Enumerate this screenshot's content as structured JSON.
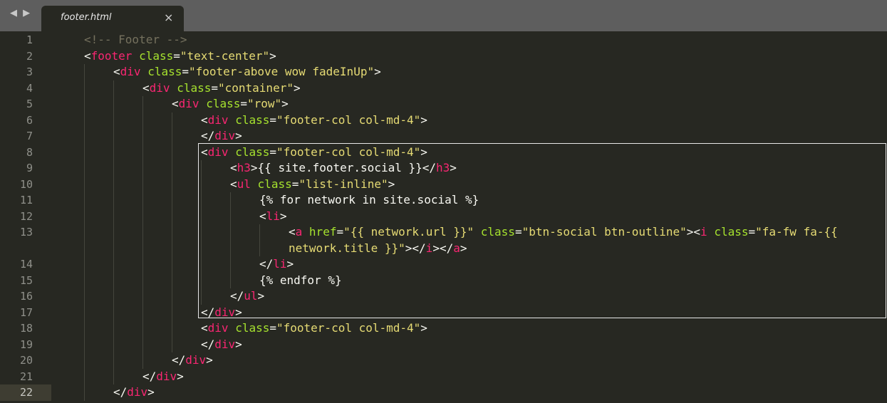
{
  "window": {
    "nav_arrows": "◀ ▶",
    "tab": {
      "title": "footer.html",
      "close": "×"
    }
  },
  "editor": {
    "current_line": 22,
    "theme": {
      "background": "#272822",
      "tag": "#f92672",
      "attribute": "#a6e22e",
      "string": "#e6db74",
      "comment": "#75715e",
      "text": "#f8f8f2"
    },
    "gutter": [
      "1",
      "2",
      "3",
      "4",
      "5",
      "6",
      "7",
      "8",
      "9",
      "10",
      "11",
      "12",
      "13",
      "",
      "14",
      "15",
      "16",
      "17",
      "18",
      "19",
      "20",
      "21",
      "22"
    ],
    "lines": [
      {
        "indent": 1,
        "tokens": [
          {
            "t": "comment",
            "v": "<!-- Footer -->"
          }
        ]
      },
      {
        "indent": 1,
        "tokens": [
          {
            "t": "punc",
            "v": "<"
          },
          {
            "t": "tag",
            "v": "footer"
          },
          {
            "t": "text",
            "v": " "
          },
          {
            "t": "attr",
            "v": "class"
          },
          {
            "t": "punc",
            "v": "="
          },
          {
            "t": "str",
            "v": "\"text-center\""
          },
          {
            "t": "punc",
            "v": ">"
          }
        ]
      },
      {
        "indent": 2,
        "tokens": [
          {
            "t": "punc",
            "v": "<"
          },
          {
            "t": "tag",
            "v": "div"
          },
          {
            "t": "text",
            "v": " "
          },
          {
            "t": "attr",
            "v": "class"
          },
          {
            "t": "punc",
            "v": "="
          },
          {
            "t": "str",
            "v": "\"footer-above wow fadeInUp\""
          },
          {
            "t": "punc",
            "v": ">"
          }
        ]
      },
      {
        "indent": 3,
        "tokens": [
          {
            "t": "punc",
            "v": "<"
          },
          {
            "t": "tag",
            "v": "div"
          },
          {
            "t": "text",
            "v": " "
          },
          {
            "t": "attr",
            "v": "class"
          },
          {
            "t": "punc",
            "v": "="
          },
          {
            "t": "str",
            "v": "\"container\""
          },
          {
            "t": "punc",
            "v": ">"
          }
        ]
      },
      {
        "indent": 4,
        "tokens": [
          {
            "t": "punc",
            "v": "<"
          },
          {
            "t": "tag",
            "v": "div"
          },
          {
            "t": "text",
            "v": " "
          },
          {
            "t": "attr",
            "v": "class"
          },
          {
            "t": "punc",
            "v": "="
          },
          {
            "t": "str",
            "v": "\"row\""
          },
          {
            "t": "punc",
            "v": ">"
          }
        ]
      },
      {
        "indent": 5,
        "tokens": [
          {
            "t": "punc",
            "v": "<"
          },
          {
            "t": "tag",
            "v": "div"
          },
          {
            "t": "text",
            "v": " "
          },
          {
            "t": "attr",
            "v": "class"
          },
          {
            "t": "punc",
            "v": "="
          },
          {
            "t": "str",
            "v": "\"footer-col col-md-4\""
          },
          {
            "t": "punc",
            "v": ">"
          }
        ]
      },
      {
        "indent": 5,
        "tokens": [
          {
            "t": "punc",
            "v": "</"
          },
          {
            "t": "tag",
            "v": "div"
          },
          {
            "t": "punc",
            "v": ">"
          }
        ]
      },
      {
        "indent": 5,
        "tokens": [
          {
            "t": "punc",
            "v": "<"
          },
          {
            "t": "tag",
            "v": "div"
          },
          {
            "t": "text",
            "v": " "
          },
          {
            "t": "attr",
            "v": "class"
          },
          {
            "t": "punc",
            "v": "="
          },
          {
            "t": "str",
            "v": "\"footer-col col-md-4\""
          },
          {
            "t": "punc",
            "v": ">"
          }
        ]
      },
      {
        "indent": 6,
        "tokens": [
          {
            "t": "punc",
            "v": "<"
          },
          {
            "t": "tag",
            "v": "h3"
          },
          {
            "t": "punc",
            "v": ">"
          },
          {
            "t": "text",
            "v": "{{ site.footer.social }}"
          },
          {
            "t": "punc",
            "v": "</"
          },
          {
            "t": "tag",
            "v": "h3"
          },
          {
            "t": "punc",
            "v": ">"
          }
        ]
      },
      {
        "indent": 6,
        "tokens": [
          {
            "t": "punc",
            "v": "<"
          },
          {
            "t": "tag",
            "v": "ul"
          },
          {
            "t": "text",
            "v": " "
          },
          {
            "t": "attr",
            "v": "class"
          },
          {
            "t": "punc",
            "v": "="
          },
          {
            "t": "str",
            "v": "\"list-inline\""
          },
          {
            "t": "punc",
            "v": ">"
          }
        ]
      },
      {
        "indent": 7,
        "tokens": [
          {
            "t": "text",
            "v": "{% for network in site.social %}"
          }
        ]
      },
      {
        "indent": 7,
        "tokens": [
          {
            "t": "punc",
            "v": "<"
          },
          {
            "t": "tag",
            "v": "li"
          },
          {
            "t": "punc",
            "v": ">"
          }
        ]
      },
      {
        "indent": 8,
        "tokens": [
          {
            "t": "punc",
            "v": "<"
          },
          {
            "t": "tag",
            "v": "a"
          },
          {
            "t": "text",
            "v": " "
          },
          {
            "t": "attr",
            "v": "href"
          },
          {
            "t": "punc",
            "v": "="
          },
          {
            "t": "str",
            "v": "\"{{ network.url }}\""
          },
          {
            "t": "text",
            "v": " "
          },
          {
            "t": "attr",
            "v": "class"
          },
          {
            "t": "punc",
            "v": "="
          },
          {
            "t": "str",
            "v": "\"btn-social btn-outline\""
          },
          {
            "t": "punc",
            "v": "><"
          },
          {
            "t": "tag",
            "v": "i"
          },
          {
            "t": "text",
            "v": " "
          },
          {
            "t": "attr",
            "v": "class"
          },
          {
            "t": "punc",
            "v": "="
          },
          {
            "t": "str",
            "v": "\"fa-fw fa-{{"
          }
        ]
      },
      {
        "indent": 8,
        "tokens": [
          {
            "t": "str",
            "v": "network.title }}\""
          },
          {
            "t": "punc",
            "v": "></"
          },
          {
            "t": "tag",
            "v": "i"
          },
          {
            "t": "punc",
            "v": "></"
          },
          {
            "t": "tag",
            "v": "a"
          },
          {
            "t": "punc",
            "v": ">"
          }
        ]
      },
      {
        "indent": 7,
        "tokens": [
          {
            "t": "punc",
            "v": "</"
          },
          {
            "t": "tag",
            "v": "li"
          },
          {
            "t": "punc",
            "v": ">"
          }
        ]
      },
      {
        "indent": 7,
        "tokens": [
          {
            "t": "text",
            "v": "{% endfor %}"
          }
        ]
      },
      {
        "indent": 6,
        "tokens": [
          {
            "t": "punc",
            "v": "</"
          },
          {
            "t": "tag",
            "v": "ul"
          },
          {
            "t": "punc",
            "v": ">"
          }
        ]
      },
      {
        "indent": 5,
        "tokens": [
          {
            "t": "punc",
            "v": "</"
          },
          {
            "t": "tag",
            "v": "div"
          },
          {
            "t": "punc",
            "v": ">"
          }
        ]
      },
      {
        "indent": 5,
        "tokens": [
          {
            "t": "punc",
            "v": "<"
          },
          {
            "t": "tag",
            "v": "div"
          },
          {
            "t": "text",
            "v": " "
          },
          {
            "t": "attr",
            "v": "class"
          },
          {
            "t": "punc",
            "v": "="
          },
          {
            "t": "str",
            "v": "\"footer-col col-md-4\""
          },
          {
            "t": "punc",
            "v": ">"
          }
        ]
      },
      {
        "indent": 5,
        "tokens": [
          {
            "t": "punc",
            "v": "</"
          },
          {
            "t": "tag",
            "v": "div"
          },
          {
            "t": "punc",
            "v": ">"
          }
        ]
      },
      {
        "indent": 4,
        "tokens": [
          {
            "t": "punc",
            "v": "</"
          },
          {
            "t": "tag",
            "v": "div"
          },
          {
            "t": "punc",
            "v": ">"
          }
        ]
      },
      {
        "indent": 3,
        "tokens": [
          {
            "t": "punc",
            "v": "</"
          },
          {
            "t": "tag",
            "v": "div"
          },
          {
            "t": "punc",
            "v": ">"
          }
        ]
      },
      {
        "indent": 2,
        "tokens": [
          {
            "t": "punc",
            "v": "</"
          },
          {
            "t": "tag",
            "v": "div"
          },
          {
            "t": "punc",
            "v": ">"
          }
        ]
      }
    ]
  }
}
